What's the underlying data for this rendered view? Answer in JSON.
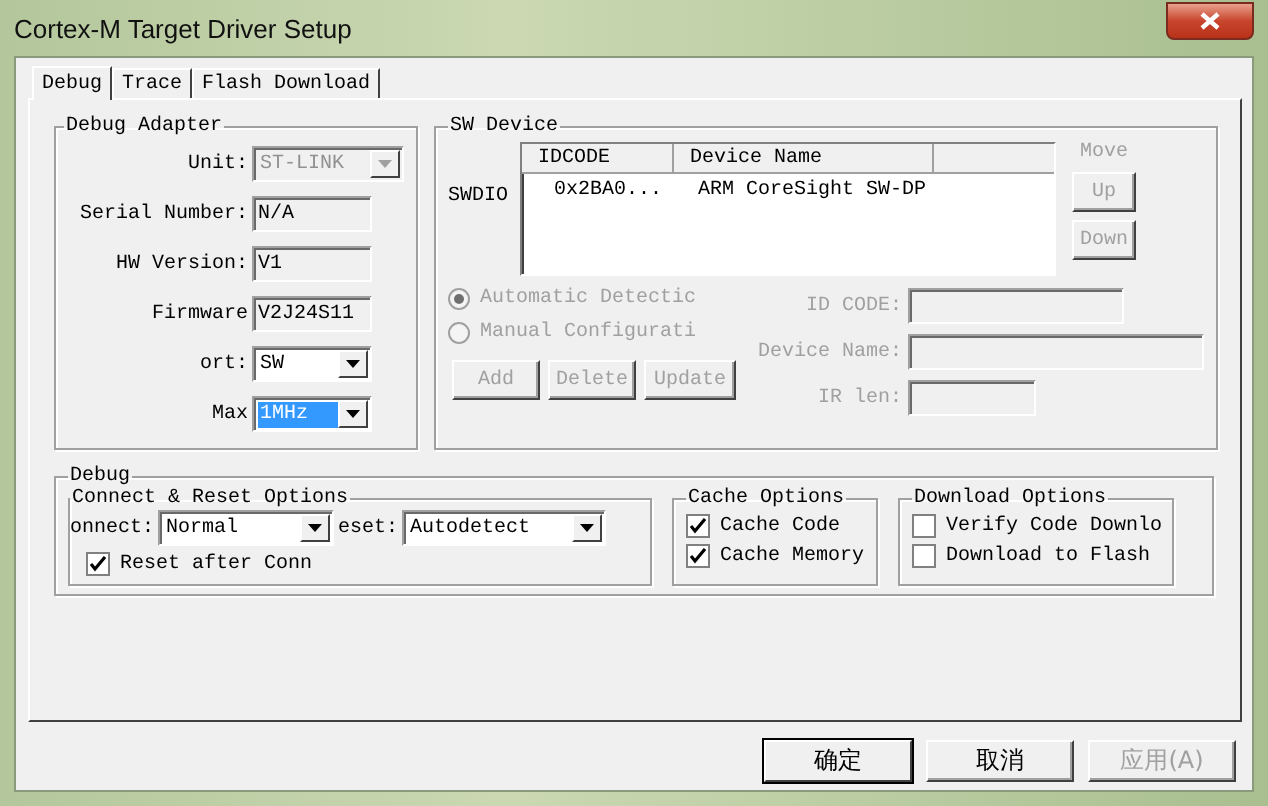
{
  "window": {
    "title": "Cortex-M Target Driver Setup"
  },
  "tabs": [
    {
      "label": "Debug",
      "selected": true
    },
    {
      "label": "Trace",
      "selected": false
    },
    {
      "label": "Flash Download",
      "selected": false
    }
  ],
  "debug_adapter": {
    "title": "Debug Adapter",
    "fields": [
      {
        "label": "Unit:",
        "value": "ST-LINK",
        "kind": "combo",
        "disabled": true,
        "highlighted": false
      },
      {
        "label": "Serial Number:",
        "value": "N/A",
        "kind": "readonly"
      },
      {
        "label": "HW Version:",
        "value": "V1",
        "kind": "readonly"
      },
      {
        "label": "Firmware",
        "value": "V2J24S11",
        "kind": "readonly"
      },
      {
        "label": "ort:",
        "value": "SW",
        "kind": "combo",
        "disabled": false,
        "highlighted": false
      },
      {
        "label": "Max",
        "value": "1MHz",
        "kind": "combo",
        "disabled": false,
        "highlighted": true
      }
    ]
  },
  "sw_device": {
    "title": "SW Device",
    "port_label": "SWDIO",
    "columns": [
      "IDCODE",
      "Device Name"
    ],
    "rows": [
      {
        "idcode": "0x2BA0...",
        "device_name": "ARM CoreSight SW-DP"
      }
    ],
    "move_label": "Move",
    "move_buttons": [
      {
        "label": "Up",
        "disabled": true
      },
      {
        "label": "Down",
        "disabled": true
      }
    ],
    "radios": [
      {
        "label": "Automatic Detectic",
        "selected": true,
        "disabled": true
      },
      {
        "label": "Manual Configurati",
        "selected": false,
        "disabled": true
      }
    ],
    "fields": [
      {
        "label": "ID CODE:"
      },
      {
        "label": "Device Name:"
      },
      {
        "label": "IR len:"
      }
    ],
    "buttons": [
      {
        "label": "Add",
        "disabled": true
      },
      {
        "label": "Delete",
        "disabled": true
      },
      {
        "label": "Update",
        "disabled": true
      }
    ]
  },
  "debug": {
    "title": "Debug",
    "connect_reset": {
      "title": "Connect & Reset Options",
      "connect_label": "onnect:",
      "connect_value": "Normal",
      "reset_label": "eset:",
      "reset_value": "Autodetect",
      "options": [
        {
          "label": "Reset after Conn",
          "checked": true
        }
      ]
    },
    "cache_options": {
      "title": "Cache Options",
      "options": [
        {
          "label": "Cache Code",
          "checked": true
        },
        {
          "label": "Cache Memory",
          "checked": true
        }
      ]
    },
    "download_options": {
      "title": "Download Options",
      "options": [
        {
          "label": "Verify Code Downlo",
          "checked": false
        },
        {
          "label": "Download to Flash",
          "checked": false
        }
      ]
    }
  },
  "footer_buttons": [
    {
      "label": "确定",
      "disabled": false,
      "default": true
    },
    {
      "label": "取消",
      "disabled": false,
      "default": false
    },
    {
      "label": "应用(A)",
      "disabled": true,
      "default": false
    }
  ]
}
